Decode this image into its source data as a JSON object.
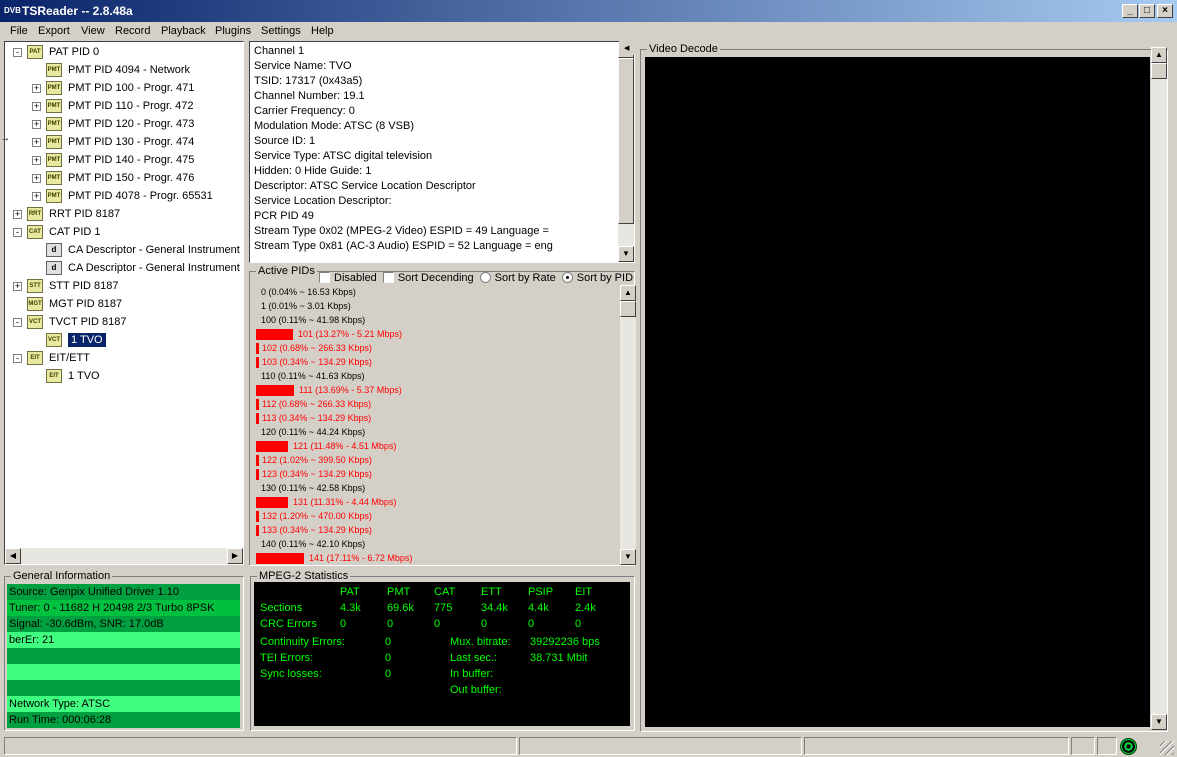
{
  "window": {
    "title": "TSReader -- 2.8.48a",
    "icon": "DVB"
  },
  "menu": [
    "File",
    "Export",
    "View",
    "Record",
    "Playback",
    "Plugins",
    "Settings",
    "Help"
  ],
  "tree": [
    {
      "label": "PAT PID 0",
      "icon": "PAT",
      "level": 0,
      "exp": "-"
    },
    {
      "label": "PMT PID 4094 - Network",
      "icon": "PMT",
      "level": 1,
      "exp": ""
    },
    {
      "label": "PMT PID 100 - Progr. 471",
      "icon": "PMT",
      "level": 1,
      "exp": "+"
    },
    {
      "label": "PMT PID 110 - Progr. 472",
      "icon": "PMT",
      "level": 1,
      "exp": "+"
    },
    {
      "label": "PMT PID 120 - Progr. 473",
      "icon": "PMT",
      "level": 1,
      "exp": "+"
    },
    {
      "label": "PMT PID 130 - Progr. 474",
      "icon": "PMT",
      "level": 1,
      "exp": "+"
    },
    {
      "label": "PMT PID 140 - Progr. 475",
      "icon": "PMT",
      "level": 1,
      "exp": "+"
    },
    {
      "label": "PMT PID 150 - Progr. 476",
      "icon": "PMT",
      "level": 1,
      "exp": "+"
    },
    {
      "label": "PMT PID 4078 - Progr. 65531",
      "icon": "PMT",
      "level": 1,
      "exp": "+"
    },
    {
      "label": "RRT PID 8187",
      "icon": "RRT",
      "level": 0,
      "exp": "+"
    },
    {
      "label": "CAT PID 1",
      "icon": "CAT",
      "level": 0,
      "exp": "-"
    },
    {
      "label": "CA Descriptor - General Instrument",
      "icon": "desc",
      "level": 1,
      "exp": ""
    },
    {
      "label": "CA Descriptor - General Instrument",
      "icon": "desc",
      "level": 1,
      "exp": ""
    },
    {
      "label": "STT PID 8187",
      "icon": "STT",
      "level": 0,
      "exp": "+"
    },
    {
      "label": "MGT PID 8187",
      "icon": "MGT",
      "level": 0,
      "exp": ""
    },
    {
      "label": "TVCT PID 8187",
      "icon": "VCT",
      "level": 0,
      "exp": "-"
    },
    {
      "label": "1 TVO",
      "icon": "VCT",
      "level": 1,
      "exp": "",
      "selected": true
    },
    {
      "label": "EIT/ETT",
      "icon": "EIT",
      "level": 0,
      "exp": "-"
    },
    {
      "label": "1 TVO",
      "icon": "EIT",
      "level": 1,
      "exp": ""
    }
  ],
  "details": [
    "Channel 1",
    "Service Name: TVO",
    "TSID: 17317 (0x43a5)",
    "Channel Number: 19.1",
    "Carrier Frequency: 0",
    "Modulation Mode: ATSC (8 VSB)",
    "Source ID: 1",
    "Service Type: ATSC digital television",
    "Hidden: 0 Hide Guide: 1",
    "Descriptor: ATSC Service Location Descriptor",
    "Service Location Descriptor:",
    " PCR PID 49",
    " Stream Type 0x02 (MPEG-2 Video) ESPID = 49 Language =",
    " Stream Type 0x81 (AC-3 Audio) ESPID = 52 Language = eng"
  ],
  "active_pids": {
    "title": "Active PIDs",
    "options": [
      {
        "label": "Disabled",
        "type": "check",
        "checked": false
      },
      {
        "label": "Sort Decending",
        "type": "check",
        "checked": false
      },
      {
        "label": "Sort by Rate",
        "type": "radio",
        "checked": false
      },
      {
        "label": "Sort by PID",
        "type": "radio",
        "checked": true
      }
    ],
    "rows": [
      {
        "text": "0 (0.04% ~ 16.53 Kbps)",
        "pct": 0.04
      },
      {
        "text": "1 (0.01% ~ 3.01 Kbps)",
        "pct": 0.01
      },
      {
        "text": "100 (0.11% ~ 41.98 Kbps)",
        "pct": 0.11
      },
      {
        "text": "101 (13.27% - 5.21 Mbps)",
        "pct": 13.27
      },
      {
        "text": "102 (0.68% ~ 266.33 Kbps)",
        "pct": 0.68
      },
      {
        "text": "103 (0.34% ~ 134.29 Kbps)",
        "pct": 0.34
      },
      {
        "text": "110 (0.11% ~ 41.63 Kbps)",
        "pct": 0.11
      },
      {
        "text": "111 (13.69% - 5.37 Mbps)",
        "pct": 13.69
      },
      {
        "text": "112 (0.68% ~ 266.33 Kbps)",
        "pct": 0.68
      },
      {
        "text": "113 (0.34% ~ 134.29 Kbps)",
        "pct": 0.34
      },
      {
        "text": "120 (0.11% ~ 44.24 Kbps)",
        "pct": 0.11
      },
      {
        "text": "121 (11.48% - 4.51 Mbps)",
        "pct": 11.48
      },
      {
        "text": "122 (1.02% ~ 399.50 Kbps)",
        "pct": 1.02
      },
      {
        "text": "123 (0.34% ~ 134.29 Kbps)",
        "pct": 0.34
      },
      {
        "text": "130 (0.11% ~ 42.58 Kbps)",
        "pct": 0.11
      },
      {
        "text": "131 (11.31% - 4.44 Mbps)",
        "pct": 11.31
      },
      {
        "text": "132 (1.20% ~ 470.00 Kbps)",
        "pct": 1.2
      },
      {
        "text": "133 (0.34% ~ 134.29 Kbps)",
        "pct": 0.34
      },
      {
        "text": "140 (0.11% ~ 42.10 Kbps)",
        "pct": 0.11
      },
      {
        "text": "141 (17.11% - 6.72 Mbps)",
        "pct": 17.11
      }
    ]
  },
  "general_info": {
    "title": "General Information",
    "rows": [
      {
        "text": "Source: Genpix Unified Driver 1.10",
        "color": "#00a040"
      },
      {
        "text": "Tuner: 0 - 11682 H 20498 2/3 Turbo 8PSK",
        "color": "#00c040"
      },
      {
        "text": "Signal: -30.6dBm, SNR: 17.0dB",
        "color": "#00a040"
      },
      {
        "text": "berEr: 21",
        "color": "#40ff80"
      },
      {
        "text": "",
        "color": "#00a040"
      },
      {
        "text": "",
        "color": "#40ff80"
      },
      {
        "text": "",
        "color": "#00a040"
      },
      {
        "text": "Network Type: ATSC",
        "color": "#40ff80"
      },
      {
        "text": "Run Time: 000:06:28",
        "color": "#00a040"
      }
    ]
  },
  "mpeg2_stats": {
    "title": "MPEG-2 Statistics",
    "headers": [
      "PAT",
      "PMT",
      "CAT",
      "ETT",
      "PSIP",
      "EIT"
    ],
    "sections_label": "Sections",
    "sections": [
      "4.3k",
      "69.6k",
      "775",
      "34.4k",
      "4.4k",
      "2.4k"
    ],
    "crc_label": "CRC Errors",
    "crc": [
      "0",
      "0",
      "0",
      "0",
      "0",
      "0"
    ],
    "continuity_label": "Continuity Errors:",
    "continuity": "0",
    "tei_label": "TEI Errors:",
    "tei": "0",
    "sync_label": "Sync losses:",
    "sync": "0",
    "mux_label": "Mux. bitrate:",
    "mux": "39292236 bps",
    "last_label": "Last sec.:",
    "last": "38.731 Mbit",
    "inbuf_label": "In buffer:",
    "outbuf_label": "Out buffer:"
  },
  "video": {
    "title": "Video Decode"
  },
  "colors": {
    "bar": "#ff0000",
    "highlight_text": "#ff0000",
    "stats_green": "#00ff00",
    "titlebar": "#0a246a"
  }
}
